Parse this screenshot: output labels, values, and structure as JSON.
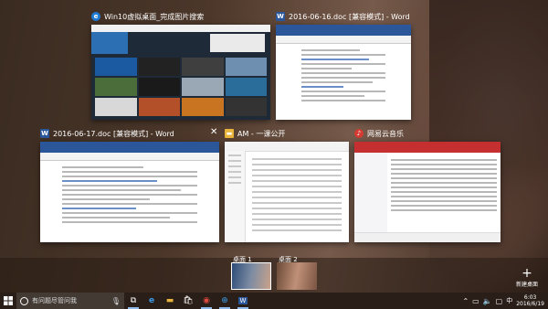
{
  "windows": [
    {
      "id": "browser",
      "title": "Win10虚拟桌面_完成图片搜索",
      "icon": "browser-icon",
      "icon_color": "#1e7ad3"
    },
    {
      "id": "word1",
      "title": "2016-06-16.doc [兼容模式] - Word",
      "icon": "word-icon",
      "icon_color": "#2b579a"
    },
    {
      "id": "word2",
      "title": "2016-06-17.doc [兼容模式] - Word",
      "icon": "word-icon",
      "icon_color": "#2b579a"
    },
    {
      "id": "explorer",
      "title": "AM - 一课公开",
      "icon": "folder-icon",
      "icon_color": "#e8b43c"
    },
    {
      "id": "music",
      "title": "网易云音乐",
      "icon": "music-icon",
      "icon_color": "#d43c33"
    }
  ],
  "desktops": {
    "items": [
      {
        "label": "桌面 1"
      },
      {
        "label": "桌面 2"
      }
    ],
    "new_desktop_label": "新建桌面"
  },
  "taskbar": {
    "search_placeholder": "有问题尽管问我",
    "clock_time": "6:03",
    "clock_date": "2016/6/19"
  },
  "colors": {
    "accent": "#8fb9e8",
    "word_blue": "#2b579a",
    "music_red": "#c62f2f"
  }
}
